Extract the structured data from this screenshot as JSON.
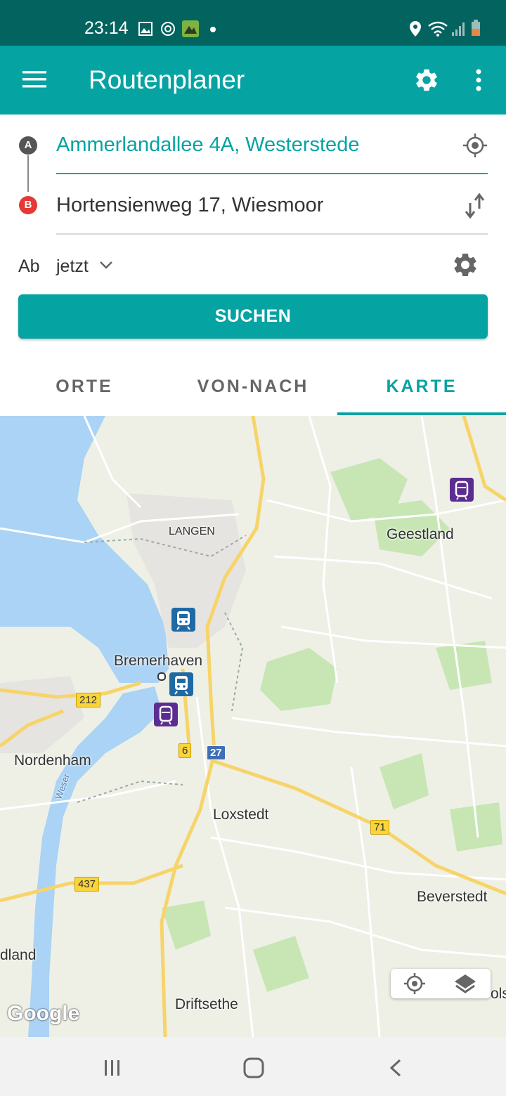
{
  "status_bar": {
    "time": "23:14"
  },
  "app_bar": {
    "title": "Routenplaner"
  },
  "route": {
    "from": "Ammerlandallee 4A, Westerstede",
    "to": "Hortensienweg 17, Wiesmoor",
    "from_marker": "A",
    "to_marker": "B"
  },
  "departure": {
    "label": "Ab",
    "value": "jetzt"
  },
  "search_button": "SUCHEN",
  "tabs": [
    {
      "label": "ORTE"
    },
    {
      "label": "VON-NACH"
    },
    {
      "label": "KARTE"
    }
  ],
  "map": {
    "labels": [
      "LANGEN",
      "Geestland",
      "Bremerhaven",
      "Nordenham",
      "Loxstedt",
      "Beverstedt",
      "dland",
      "Driftsethe",
      "Weser",
      "ols"
    ],
    "road_numbers": [
      "212",
      "6",
      "27",
      "71",
      "437"
    ],
    "attribution": "Google"
  },
  "colors": {
    "primary": "#06a3a3",
    "primary_dark": "#02635f",
    "marker_b": "#e53935",
    "marker_a": "#555555"
  }
}
